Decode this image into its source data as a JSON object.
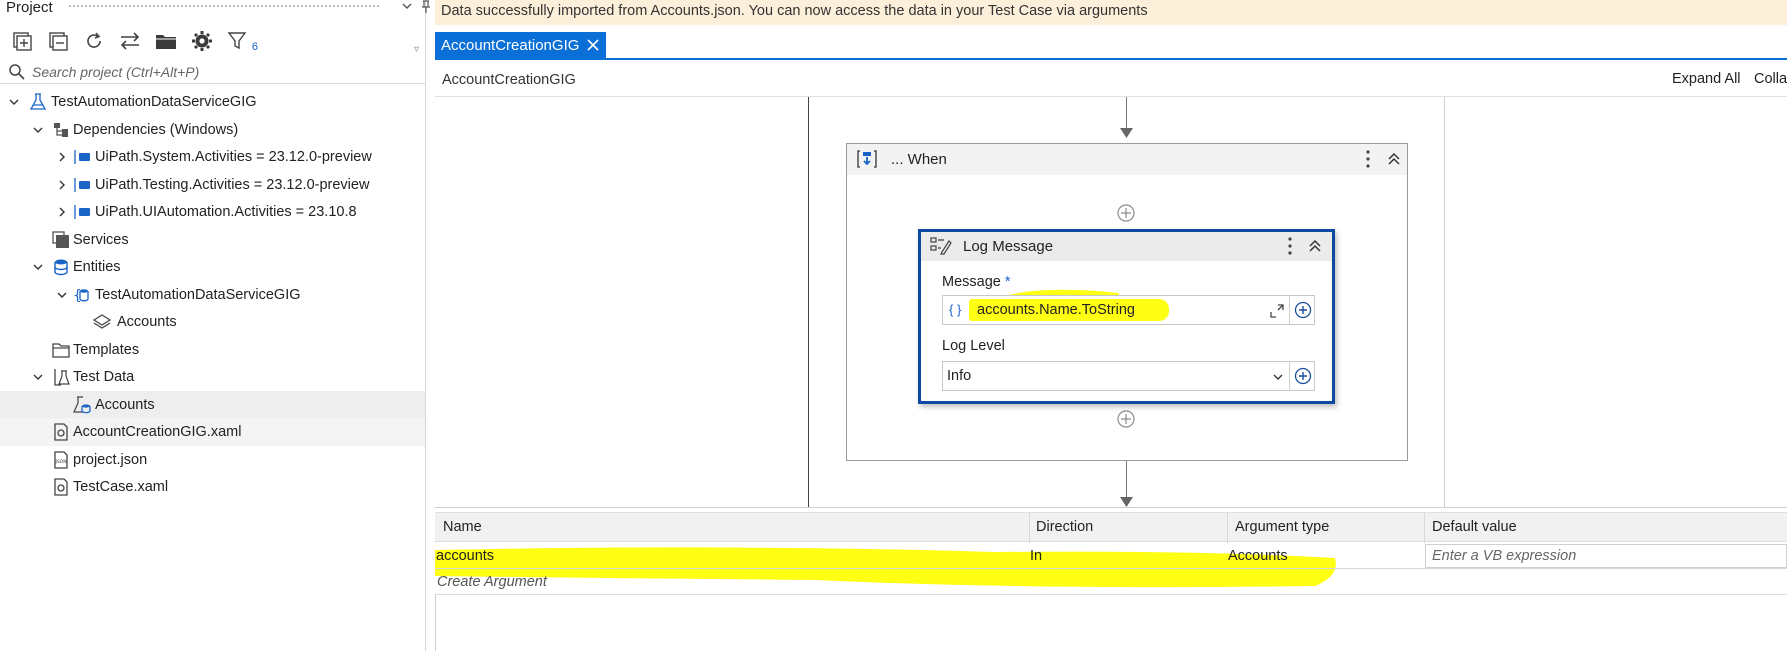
{
  "project_panel": {
    "title": "Project",
    "search_placeholder": "Search project (Ctrl+Alt+P)",
    "filter_count": "6",
    "tree": [
      {
        "label": "TestAutomationDataServiceGIG",
        "level": 0,
        "icon": "test-project-icon",
        "expanded": true
      },
      {
        "label": "Dependencies (Windows)",
        "level": 1,
        "icon": "dependencies-icon",
        "expanded": true
      },
      {
        "label": "UiPath.System.Activities = 23.12.0-preview",
        "level": 2,
        "icon": "package-icon",
        "expanded": false
      },
      {
        "label": "UiPath.Testing.Activities = 23.12.0-preview",
        "level": 2,
        "icon": "package-icon",
        "expanded": false
      },
      {
        "label": "UiPath.UIAutomation.Activities = 23.10.8",
        "level": 2,
        "icon": "package-icon",
        "expanded": false
      },
      {
        "label": "Services",
        "level": 1,
        "icon": "services-icon"
      },
      {
        "label": "Entities",
        "level": 1,
        "icon": "database-icon",
        "expanded": true
      },
      {
        "label": "TestAutomationDataServiceGIG",
        "level": 2,
        "icon": "entity-db-icon",
        "expanded": true
      },
      {
        "label": "Accounts",
        "level": 3,
        "icon": "layers-icon"
      },
      {
        "label": "Templates",
        "level": 1,
        "icon": "folder-icon"
      },
      {
        "label": "Test Data",
        "level": 1,
        "icon": "test-data-icon",
        "expanded": true
      },
      {
        "label": "Accounts",
        "level": 2,
        "icon": "test-data-file-icon"
      },
      {
        "label": "AccountCreationGIG.xaml",
        "level": 1,
        "icon": "xaml-icon"
      },
      {
        "label": "project.json",
        "level": 1,
        "icon": "json-icon"
      },
      {
        "label": "TestCase.xaml",
        "level": 1,
        "icon": "xaml-icon"
      }
    ]
  },
  "banner": {
    "text": "Data successfully imported from Accounts.json. You can now access the data in your Test Case via arguments"
  },
  "tab": {
    "label": "AccountCreationGIG"
  },
  "breadcrumb": {
    "label": "AccountCreationGIG"
  },
  "toolbar": {
    "expand_all": "Expand All",
    "collapse_all": "Colla"
  },
  "when_block": {
    "title": "... When"
  },
  "log_message": {
    "title": "Log Message",
    "message_label": "Message",
    "required_mark": "*",
    "braces": "{ }",
    "message_value": "accounts.Name.ToString",
    "log_level_label": "Log Level",
    "log_level_value": "Info"
  },
  "arguments": {
    "columns": [
      "Name",
      "Direction",
      "Argument type",
      "Default value"
    ],
    "rows": [
      {
        "name": "accounts",
        "direction": "In",
        "type": "Accounts",
        "default_placeholder": "Enter a VB expression"
      }
    ],
    "create_label": "Create Argument"
  },
  "colors": {
    "accent": "#0a6fd6",
    "highlight": "#ffff14",
    "banner": "#fdf0da",
    "selection_border": "#0b4aa0"
  }
}
